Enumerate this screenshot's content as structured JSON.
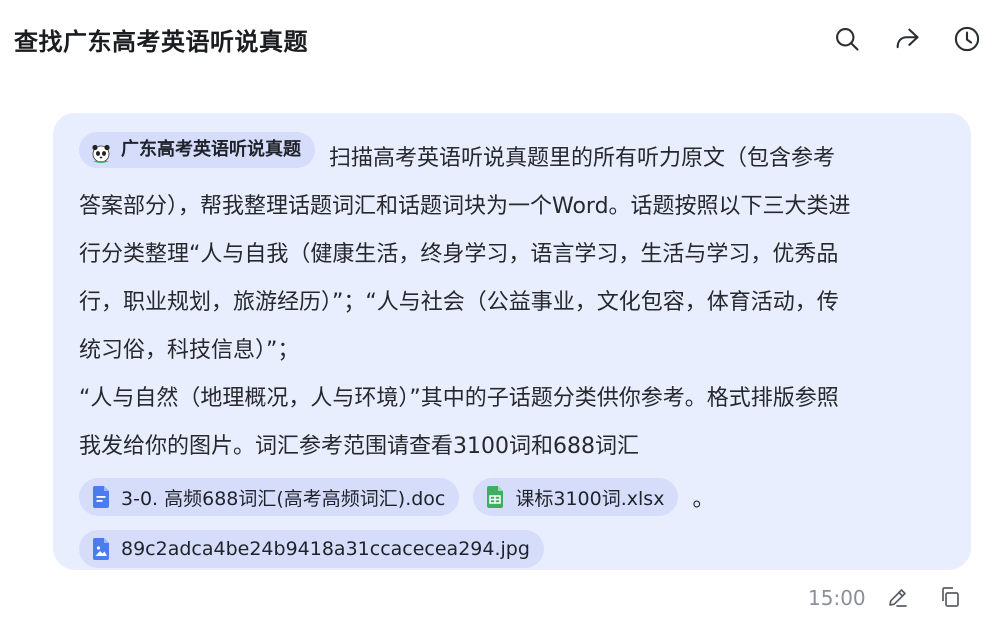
{
  "header": {
    "title": "查找广东高考英语听说真题",
    "icons": [
      "search-icon",
      "share-icon",
      "history-icon"
    ]
  },
  "message": {
    "mention": {
      "label": "广东高考英语听说真题",
      "icon": "panda-icon"
    },
    "lines": [
      "扫描高考英语听说真题里的所有听力原文（包含参考",
      "答案部分），帮我整理话题词汇和话题词块为一个Word。话题按照以下三大类进",
      "行分类整理“人与自我（健康生活，终身学习，语言学习，生活与学习，优秀品",
      "行，职业规划，旅游经历）”；“人与社会（公益事业，文化包容，体育活动，传",
      "统习俗，科技信息）”；",
      "“人与自然（地理概况，人与环境）”其中的子话题分类供你参考。格式排版参照",
      "我发给你的图片。词汇参考范围请查看3100词和688词汇"
    ],
    "attachments": [
      {
        "name": "3-0. 高频688词汇(高考高频词汇).doc",
        "type": "doc",
        "color": "#4a7cf0"
      },
      {
        "name": "课标3100词.xlsx",
        "type": "xlsx",
        "color": "#3fae63"
      },
      {
        "name": "89c2adca4be24b9418a31ccacecea294.jpg",
        "type": "image",
        "color": "#4a7cf0"
      }
    ],
    "period": "。"
  },
  "footer": {
    "time": "15:00",
    "icons": [
      "edit-icon",
      "copy-icon"
    ]
  }
}
